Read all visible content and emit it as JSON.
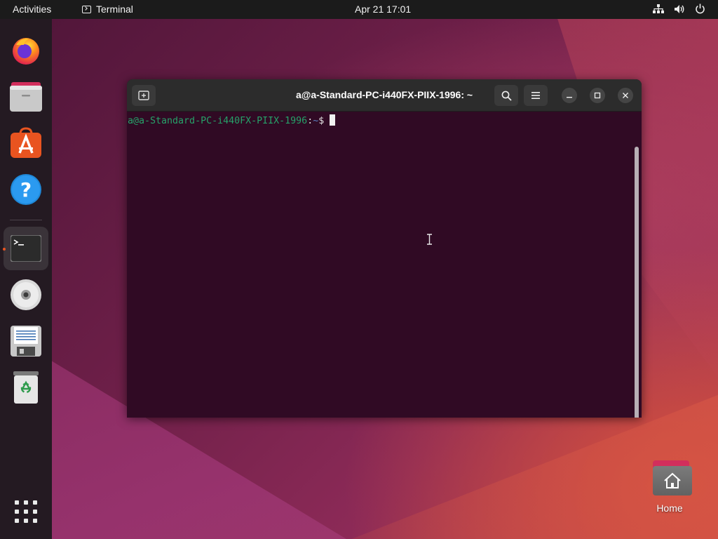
{
  "topbar": {
    "activities": "Activities",
    "app_name": "Terminal",
    "clock": "Apr 21  17:01",
    "tray_icons": [
      "network-icon",
      "volume-icon",
      "power-icon"
    ]
  },
  "dock": {
    "items": [
      {
        "name": "Firefox",
        "icon": "firefox-icon"
      },
      {
        "name": "Files",
        "icon": "files-icon"
      },
      {
        "name": "Ubuntu Software",
        "icon": "app-store-icon"
      },
      {
        "name": "Help",
        "icon": "help-icon"
      },
      {
        "name": "Terminal",
        "icon": "terminal-icon",
        "active": true
      },
      {
        "name": "Disc",
        "icon": "cd-icon"
      },
      {
        "name": "Installer",
        "icon": "floppy-icon"
      },
      {
        "name": "Trash",
        "icon": "trash-icon"
      }
    ],
    "show_apps_icon": "grid-icon"
  },
  "terminal": {
    "title": "a@a-Standard-PC-i440FX-PIIX-1996: ~",
    "prompt": {
      "userhost": "a@a-Standard-PC-i440FX-PIIX-1996",
      "sep": ":",
      "path": "~",
      "symbol": "$"
    }
  },
  "desktop": {
    "home_label": "Home"
  },
  "colors": {
    "accent": "#e95420",
    "terminal_bg": "#300a24",
    "prompt_green": "#26a269",
    "prompt_blue": "#5b7fbf"
  }
}
